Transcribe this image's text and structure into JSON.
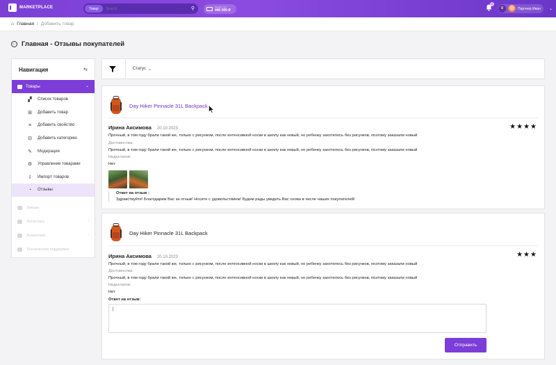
{
  "header": {
    "logo_text": "MARKETPLACE",
    "search": {
      "category": "Товар",
      "placeholder": "Search"
    },
    "balance": {
      "label": "Баланс счёт",
      "value": "440 000 ₽"
    },
    "notifications_count": "1",
    "user_name": "Партнер Иван"
  },
  "breadcrumb": {
    "home": "Главная",
    "separator": "/",
    "current": "Добавить товар"
  },
  "page_title": "Главная - Отзывы покупателей",
  "sidebar": {
    "title": "Навигация",
    "group": "Товары",
    "items": [
      {
        "label": "Список товаров",
        "icon": "boxes-icon"
      },
      {
        "label": "Добавить товар",
        "icon": "plus-square-icon"
      },
      {
        "label": "Добавить свойство",
        "icon": "list-plus-icon"
      },
      {
        "label": "Добавить категорию",
        "icon": "tray-icon"
      },
      {
        "label": "Модерация",
        "icon": "edit-icon"
      },
      {
        "label": "Управление товарами",
        "icon": "wrench-icon"
      },
      {
        "label": "Импорт товаров",
        "icon": "import-icon"
      },
      {
        "label": "Отзывы",
        "icon": "chat-icon"
      }
    ],
    "faded": [
      "Заказы",
      "Логистика",
      "Аналитика",
      "Техническая поддержка"
    ]
  },
  "filter": {
    "status_label": "Статус"
  },
  "reviews": [
    {
      "product": "Day Hiker Pinnacle 31L Backpack",
      "author": "Ирина Аксимова",
      "date": "20.10.2023",
      "rating": 4,
      "stars": "★★★★",
      "text": "Прочный, в том году брали такой же, только с рисунком, после интенсивной носки в школу как новый, но ребенку захотелось без рисунков, поэтому заказали новый",
      "advantages_label": "Достоинства:",
      "advantages": "Прочный, в том году брали такой же, только с рисунком, после интенсивной носки в школу как новый, но ребенку захотелось без рисунков, поэтому заказали новый",
      "disadvantages_label": "Недостатки:",
      "disadvantages": "Нет",
      "reply_title": "Ответ на отзыв :",
      "reply_text": "Здравствуйте! Благодарим Вас за отзыв! Носите с удовольствием! Будем рады увидеть Вас снова в числе наших покупателей!"
    },
    {
      "product": "Day Hiker Pinnacle 31L Backpack",
      "author": "Ирина Аксимова",
      "date": "20.10.2023",
      "rating": 3,
      "stars": "★★★",
      "text": "Прочный, в том году брали такой же, только с рисунком, после интенсивной носки в школу как новый, но ребенку захотелось без рисунков, поэтому заказали новый",
      "advantages_label": "Достоинства:",
      "advantages": "Прочный, в том году брали такой же, только с рисунком, после интенсивной носки в школу как новый, но ребенку захотелось без рисунков, поэтому заказали новый",
      "disadvantages_label": "Недостатки:",
      "disadvantages": "Нет",
      "answer_label": "Ответ на отзыв:",
      "answer_value": "|",
      "send_label": "Отправить"
    }
  ],
  "colors": {
    "accent": "#7c3dd9",
    "link": "#6d34c9"
  }
}
